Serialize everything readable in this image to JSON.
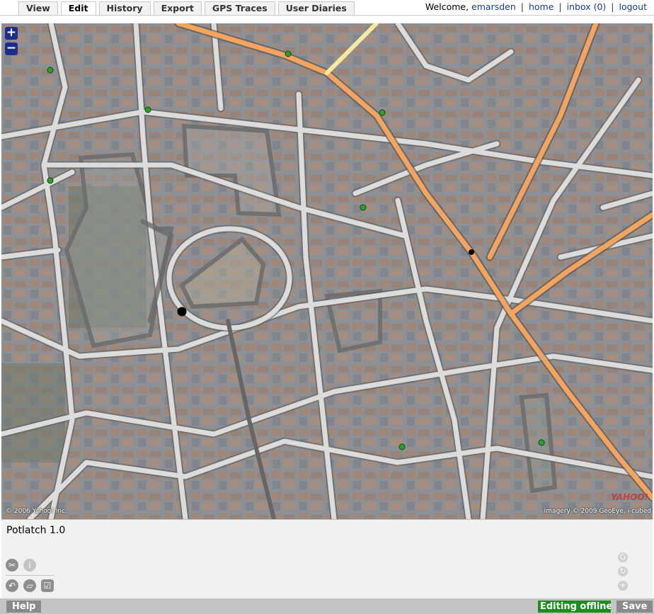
{
  "tabs": [
    {
      "label": "View"
    },
    {
      "label": "Edit",
      "active": true
    },
    {
      "label": "History"
    },
    {
      "label": "Export"
    },
    {
      "label": "GPS Traces"
    },
    {
      "label": "User Diaries"
    }
  ],
  "userbar": {
    "welcome": "Welcome,",
    "username": "emarsden",
    "home": "home",
    "inbox": "inbox (0)",
    "logout": "logout",
    "separator": "|"
  },
  "map": {
    "zoom_in": "+",
    "zoom_out": "−",
    "copyright_left": "© 2006 Yahoo! Inc.",
    "copyright_right": "Imagery © 2009 GeoEye, i-cubed",
    "logo": "YAHOO!",
    "colors": {
      "aerial": "#8d9298",
      "road": "#dcdcdc",
      "road_edge": "#6a6a6a",
      "primary": "#f4a45e",
      "trunk": "#f4eaa0",
      "area": "#6e6e6e",
      "poi": "#2aa02a",
      "node": "#000000"
    }
  },
  "panel": {
    "title": "Potlatch 1.0",
    "icons": [
      "scissors-icon",
      "info-icon",
      "undo-icon",
      "gps-icon",
      "check-icon"
    ],
    "right_icons": [
      "gps-right-icon",
      "refresh-icon",
      "add-icon"
    ]
  },
  "bottombar": {
    "help": "Help",
    "status": "Editing offline",
    "save": "Save"
  }
}
